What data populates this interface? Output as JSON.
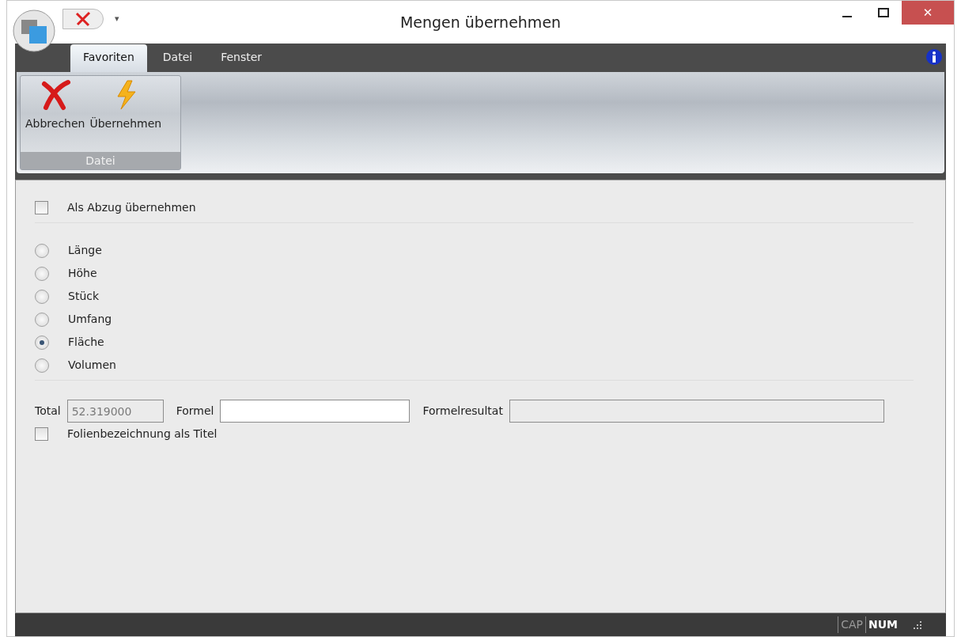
{
  "window": {
    "title": "Mengen übernehmen"
  },
  "quick_access": {
    "dropdown_glyph": "▾"
  },
  "window_controls": {
    "close_glyph": "✕"
  },
  "tabs": [
    {
      "label": "Favoriten",
      "selected": true
    },
    {
      "label": "Datei",
      "selected": false
    },
    {
      "label": "Fenster",
      "selected": false
    }
  ],
  "ribbon": {
    "groups": [
      {
        "label": "Datei",
        "buttons": [
          {
            "label": "Abbrechen",
            "kind": "cancel"
          },
          {
            "label": "Übernehmen",
            "kind": "apply"
          }
        ]
      }
    ]
  },
  "deduction": {
    "label": "Als Abzug übernehmen",
    "checked": false
  },
  "quantity_types": [
    {
      "label": "Länge",
      "selected": false
    },
    {
      "label": "Höhe",
      "selected": false
    },
    {
      "label": "Stück",
      "selected": false
    },
    {
      "label": "Umfang",
      "selected": false
    },
    {
      "label": "Fläche",
      "selected": true
    },
    {
      "label": "Volumen",
      "selected": false
    }
  ],
  "fields": [
    {
      "label": "Total",
      "value": "52.319000",
      "disabled": true
    },
    {
      "label": "Formel",
      "disabled": false
    },
    {
      "label": "Formelresultat",
      "disabled": true
    }
  ],
  "foil_title": {
    "label": "Folienbezeichnung als Titel",
    "checked": false
  },
  "status_bar": {
    "indicators": [
      {
        "label": "CAP",
        "on": false
      },
      {
        "label": "NUM",
        "on": true
      }
    ]
  }
}
